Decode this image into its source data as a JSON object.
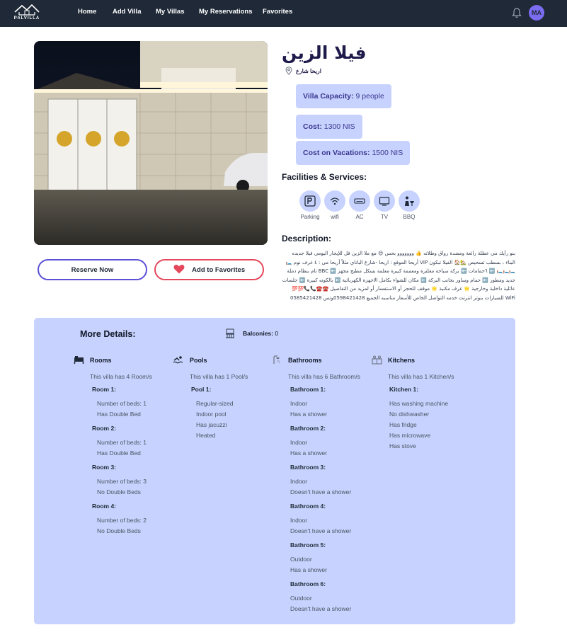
{
  "nav": {
    "logo_text": "PALVILLA",
    "links": [
      "Home",
      "Add Villa",
      "My Villas",
      "My Reservations",
      "Favorites"
    ],
    "avatar": "MA"
  },
  "villa": {
    "title": "فيلا الزين",
    "location": "اريحا شارع",
    "capacity_label": "Villa Capacity:",
    "capacity_value": "9 people",
    "cost_label": "Cost:",
    "cost_value": "1300 NIS",
    "vac_label": "Cost on Vacations:",
    "vac_value": "1500 NIS"
  },
  "buttons": {
    "reserve": "Reserve Now",
    "favorite": "Add to Favorites"
  },
  "facilities": {
    "title": "Facilities & Services:",
    "items": [
      "Parking",
      "wifi",
      "AC",
      "TV",
      "BBQ"
    ]
  },
  "description": {
    "title": "Description:",
    "text": "بنو رأيك مي عطلة رائعة ومضدة رواق وطلاته 👍 ووووووو بحس 😍 مع ملا الزين فل للإيجار اليومي فيلا جديده البناء ، بسطب تسحيص 🏡🏠 الفيلا تبكون VIP أريحا الموقع : اريحا -شارع الباناي مثلاً أريحا مى : ٤ غرف نوم 🛏️🛏️🛏️🛏️ ⬅️ ٦حمامات ⬅️ بركة سباحة مغلترة ومعممة كبيرة معلمة بسكل مطبخ مجهز ⬅️ BBC تام بنظام دملة جديد ومطور ⬅️ حمام وساور بجانب البركة ⬅️ مكان للشواء بكامل الاجهزة الكهربائية ⬅️ بالكونه كبيرة ⬅️ جلسات عائلية داخلية وخارجية 🌟 غرف مكنية 🌟 موقف للحجز أو الاستفسار أو لمزيد من التفاصيل ☎️☎️📞📞💯💯 WiFi للسيارات بنوتر انترنت خدمه التواصل الخاص للأسعار مناسبه الجميع 0598421428وتس 0585421428"
  },
  "details": {
    "title": "More Details:",
    "balconies_label": "Balconies:",
    "balconies_value": "0",
    "rooms": {
      "heading": "Rooms",
      "summary": "This villa has 4 Room/s",
      "entries": [
        {
          "name": "Room 1:",
          "lines": [
            "Number of beds: 1",
            "Has Double Bed"
          ]
        },
        {
          "name": "Room 2:",
          "lines": [
            "Number of beds: 1",
            "Has Double Bed"
          ]
        },
        {
          "name": "Room 3:",
          "lines": [
            "Number of beds: 3",
            "No Double Beds"
          ]
        },
        {
          "name": "Room 4:",
          "lines": [
            "Number of beds: 2",
            "No Double Beds"
          ]
        }
      ]
    },
    "pools": {
      "heading": "Pools",
      "summary": "This villa has 1 Pool/s",
      "entries": [
        {
          "name": "Pool 1:",
          "lines": [
            "Regular-sized",
            "Indoor pool",
            "Has jacuzzi",
            "Heated"
          ]
        }
      ]
    },
    "bathrooms": {
      "heading": "Bathrooms",
      "summary": "This villa has 6 Bathroom/s",
      "entries": [
        {
          "name": "Bathroom 1:",
          "lines": [
            "Indoor",
            "Has a shower"
          ]
        },
        {
          "name": "Bathroom 2:",
          "lines": [
            "Indoor",
            "Has a shower"
          ]
        },
        {
          "name": "Bathroom 3:",
          "lines": [
            "Indoor",
            "Doesn't have a shower"
          ]
        },
        {
          "name": "Bathroom 4:",
          "lines": [
            "Indoor",
            "Doesn't have a shower"
          ]
        },
        {
          "name": "Bathroom 5:",
          "lines": [
            "Outdoor",
            "Has a shower"
          ]
        },
        {
          "name": "Bathroom 6:",
          "lines": [
            "Outdoor",
            "Doesn't have a shower"
          ]
        }
      ]
    },
    "kitchens": {
      "heading": "Kitchens",
      "summary": "This villa has 1 Kitchen/s",
      "entries": [
        {
          "name": "Kitchen 1:",
          "lines": [
            "Has washing machine",
            "No dishwasher",
            "Has fridge",
            "Has microwave",
            "Has stove"
          ]
        }
      ]
    }
  },
  "colors": {
    "navbar": "#1f2937",
    "panel": "#c7d2fe",
    "reserve_border": "#5b4fd6",
    "favorite_border": "#e5485b",
    "avatar": "#7c6cf0"
  }
}
